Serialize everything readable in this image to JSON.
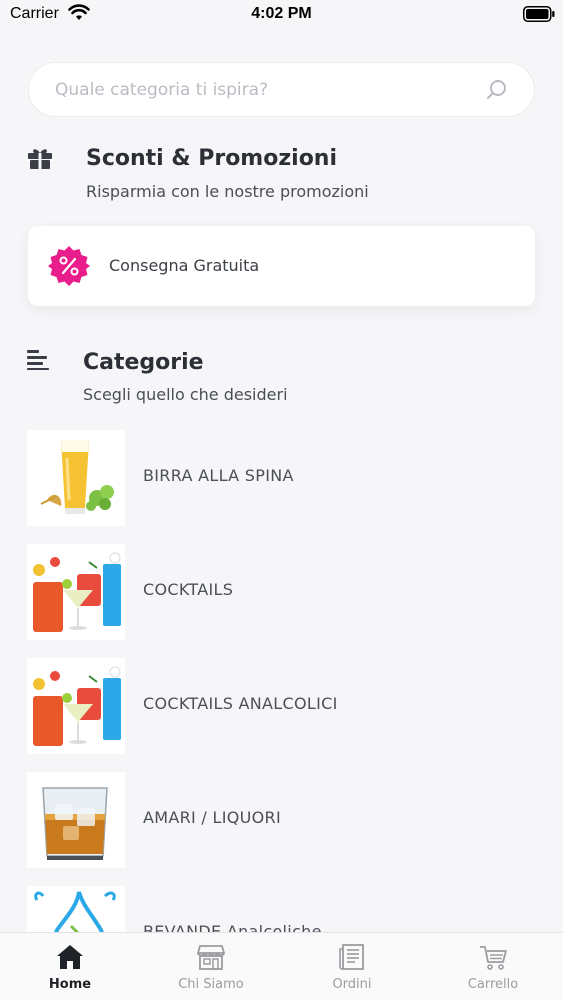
{
  "status_bar": {
    "carrier": "Carrier",
    "time": "4:02 PM"
  },
  "search": {
    "placeholder": "Quale categoria ti ispira?",
    "value": ""
  },
  "promotions": {
    "title": "Sconti & Promozioni",
    "subtitle": "Risparmia con le nostre promozioni",
    "items": [
      {
        "label": "Consegna Gratuita",
        "icon": "percent-badge-icon",
        "color": "#e91e8c"
      }
    ]
  },
  "categories": {
    "title": "Categorie",
    "subtitle": "Scegli quello che desideri",
    "items": [
      {
        "label": "BIRRA ALLA SPINA",
        "image": "beer-glass"
      },
      {
        "label": "COCKTAILS",
        "image": "cocktail-glasses"
      },
      {
        "label": "COCKTAILS ANALCOLICI",
        "image": "cocktail-glasses"
      },
      {
        "label": "AMARI / LIQUORI",
        "image": "whisky-glass"
      },
      {
        "label": "BEVANDE Analcoliche",
        "image": "water-drop"
      }
    ]
  },
  "tabbar": {
    "active": "Home",
    "tabs": [
      {
        "label": "Home",
        "icon": "home-icon"
      },
      {
        "label": "Chi Siamo",
        "icon": "store-icon"
      },
      {
        "label": "Ordini",
        "icon": "receipt-icon"
      },
      {
        "label": "Carrello",
        "icon": "cart-icon"
      }
    ]
  }
}
